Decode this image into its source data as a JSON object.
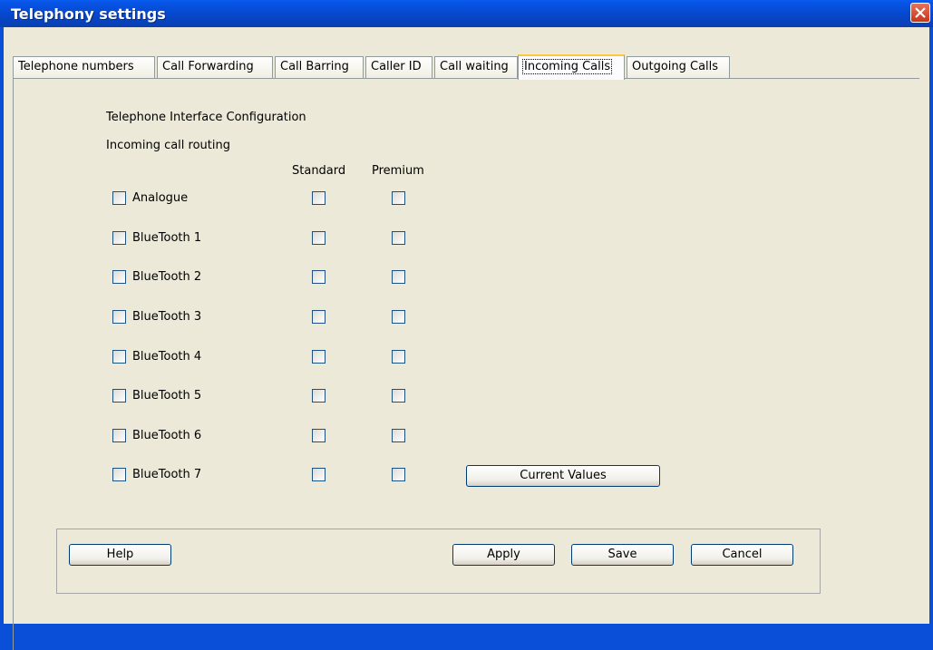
{
  "window": {
    "title": "Telephony settings"
  },
  "tabs": [
    {
      "label": "Telephone numbers"
    },
    {
      "label": "Call Forwarding"
    },
    {
      "label": "Call Barring"
    },
    {
      "label": "Caller ID"
    },
    {
      "label": "Call waiting"
    },
    {
      "label": "Incoming Calls",
      "active": true
    },
    {
      "label": "Outgoing Calls"
    }
  ],
  "content": {
    "heading": "Telephone Interface Configuration",
    "subheading": "Incoming call routing",
    "col_standard": "Standard",
    "col_premium": "Premium",
    "rows": [
      {
        "label": "Analogue",
        "enabled": false,
        "standard": false,
        "premium": false
      },
      {
        "label": "BlueTooth 1",
        "enabled": false,
        "standard": false,
        "premium": false
      },
      {
        "label": "BlueTooth 2",
        "enabled": false,
        "standard": false,
        "premium": false
      },
      {
        "label": "BlueTooth 3",
        "enabled": false,
        "standard": false,
        "premium": false
      },
      {
        "label": "BlueTooth 4",
        "enabled": false,
        "standard": false,
        "premium": false
      },
      {
        "label": "BlueTooth 5",
        "enabled": false,
        "standard": false,
        "premium": false
      },
      {
        "label": "BlueTooth 6",
        "enabled": false,
        "standard": false,
        "premium": false
      },
      {
        "label": "BlueTooth 7",
        "enabled": false,
        "standard": false,
        "premium": false
      }
    ],
    "current_values_label": "Current Values"
  },
  "footer": {
    "help_label": "Help",
    "apply_label": "Apply",
    "save_label": "Save",
    "cancel_label": "Cancel"
  },
  "colors": {
    "titlebar": "#0a4fd8",
    "client_bg": "#ece9d8",
    "active_tab_accent": "#ffc83c"
  }
}
